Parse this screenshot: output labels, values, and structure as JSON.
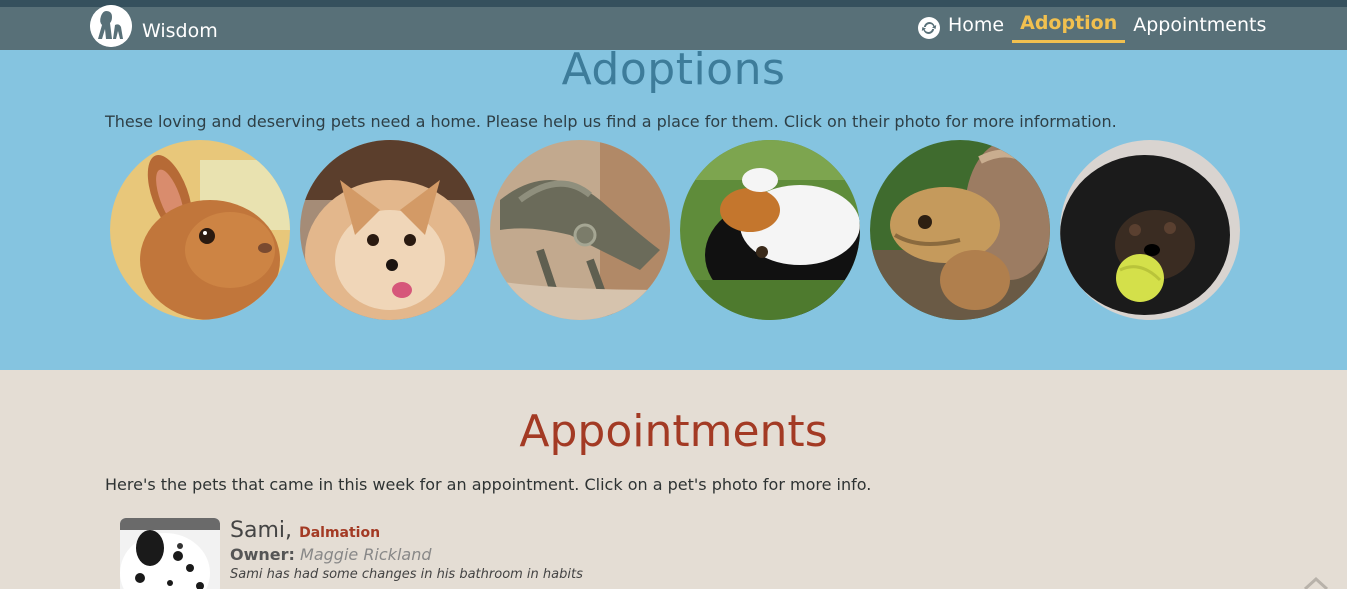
{
  "brand": {
    "name": "Wisdom"
  },
  "nav": {
    "items": [
      {
        "label": "Home",
        "active": false
      },
      {
        "label": "Adoption",
        "active": true
      },
      {
        "label": "Appointments",
        "active": false
      }
    ]
  },
  "adoptions": {
    "title": "Adoptions",
    "intro": "These loving and deserving pets need a home. Please help us find a place for them. Click on their photo for more information.",
    "pets": [
      "rabbit",
      "pomeranian",
      "iguana",
      "guinea pig",
      "tortoise",
      "terrier"
    ]
  },
  "appointments": {
    "title": "Appointments",
    "intro": "Here's the pets that came in this week for an appointment. Click on a pet's photo for more info.",
    "items": [
      {
        "name": "Sami,",
        "breed": "Dalmation",
        "owner_label": "Owner:",
        "owner": "Maggie Rickland",
        "note": "Sami has had some changes in his bathroom in habits"
      }
    ]
  },
  "colors": {
    "navbar": "#587078",
    "adoptions_bg": "#85c4e0",
    "appointments_bg": "#e4ddd4",
    "active_nav": "#f1c04f",
    "appointments_title": "#a33a24",
    "adoptions_title": "#3d7c9a"
  }
}
